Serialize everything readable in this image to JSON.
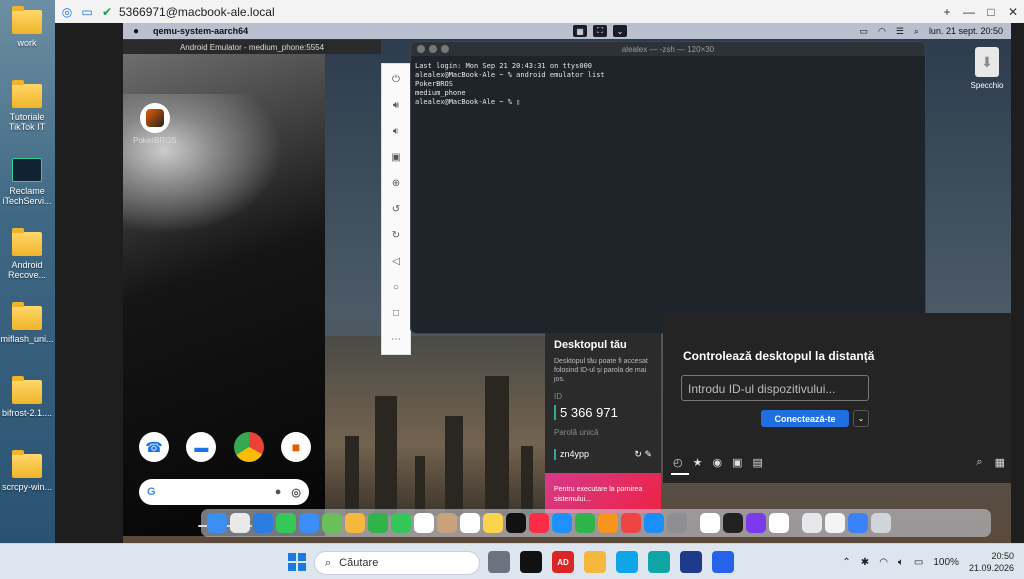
{
  "window": {
    "title": "5366971@macbook-ale.local",
    "controls": [
      "+",
      "—",
      "□",
      "✕"
    ]
  },
  "desktop_icons": [
    {
      "label": "work"
    },
    {
      "label": "Tutoriale TikTok IT"
    },
    {
      "label": "Reclame iTechServi..."
    },
    {
      "label": "Android Recove..."
    },
    {
      "label": "miflash_uni..."
    },
    {
      "label": "bifrost-2.1...."
    },
    {
      "label": "scrcpy-win..."
    }
  ],
  "mac": {
    "menubar": {
      "app": "qemu-system-aarch64",
      "datetime": "lun. 21 sept.  20:50"
    },
    "desktop_item": "Specchio",
    "emulator": {
      "title": "Android Emulator - medium_phone:5554",
      "app_label": "PokerBROS"
    },
    "terminal": {
      "title": "alealex — -zsh — 120×30",
      "lines": [
        "Last login: Mon Sep 21 20:43:31 on ttys000",
        "alealex@MacBook-Ale ~ % android emulator list",
        "PokerBROS",
        "medium_phone",
        "alealex@MacBook-Ale ~ % ▯"
      ]
    },
    "anydesk": {
      "desk_title": "Desktopul tău",
      "desk_desc": "Desktopul tău poate fi accesat folosind ID-ul și parola de mai jos.",
      "id_label": "ID",
      "id_value": "5 366 971",
      "pw_label": "Parolă unică",
      "pw_value": "zn4ypp",
      "promo": "Pentru executare la pornirea sistemului...",
      "remote_title": "Controlează desktopul la distanță",
      "id_placeholder": "Introdu ID-ul dispozitivului...",
      "connect_label": "Conectează-te"
    }
  },
  "taskbar": {
    "search_placeholder": "Căutare",
    "battery": "100%",
    "time": "20:50",
    "date": "21.09.2026"
  }
}
